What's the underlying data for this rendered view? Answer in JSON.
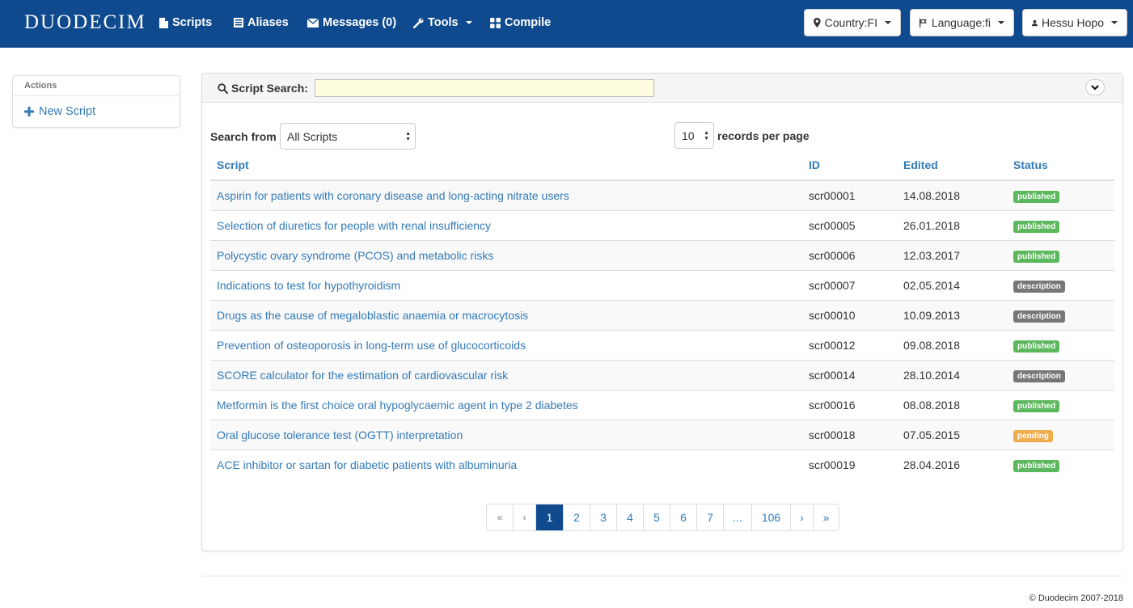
{
  "brand": "DUODECIM",
  "nav": {
    "scripts": "Scripts",
    "aliases": "Aliases",
    "messages": "Messages (0)",
    "tools": "Tools",
    "compile": "Compile",
    "country": "Country:FI",
    "language": "Language:fi",
    "user": "Hessu Hopo"
  },
  "sidebar": {
    "heading": "Actions",
    "new_script": "New Script"
  },
  "search": {
    "label": "Script Search:",
    "value": ""
  },
  "filters": {
    "search_from_label": "Search from",
    "search_from_value": "All Scripts",
    "per_page_value": "10",
    "records_label": "records per page"
  },
  "table": {
    "headers": [
      "Script",
      "ID",
      "Edited",
      "Status"
    ],
    "rows": [
      {
        "script": "Aspirin for patients with coronary disease and long-acting nitrate users",
        "id": "scr00001",
        "edited": "14.08.2018",
        "status": "published"
      },
      {
        "script": "Selection of diuretics for people with renal insufficiency",
        "id": "scr00005",
        "edited": "26.01.2018",
        "status": "published"
      },
      {
        "script": "Polycystic ovary syndrome (PCOS) and metabolic risks",
        "id": "scr00006",
        "edited": "12.03.2017",
        "status": "published"
      },
      {
        "script": "Indications to test for hypothyroidism",
        "id": "scr00007",
        "edited": "02.05.2014",
        "status": "description"
      },
      {
        "script": "Drugs as the cause of megaloblastic anaemia or macrocytosis",
        "id": "scr00010",
        "edited": "10.09.2013",
        "status": "description"
      },
      {
        "script": "Prevention of osteoporosis in long-term use of glucocorticoids",
        "id": "scr00012",
        "edited": "09.08.2018",
        "status": "published"
      },
      {
        "script": "SCORE calculator for the estimation of cardiovascular risk",
        "id": "scr00014",
        "edited": "28.10.2014",
        "status": "description"
      },
      {
        "script": "Metformin is the first choice oral hypoglycaemic agent in type 2 diabetes",
        "id": "scr00016",
        "edited": "08.08.2018",
        "status": "published"
      },
      {
        "script": "Oral glucose tolerance test (OGTT) interpretation",
        "id": "scr00018",
        "edited": "07.05.2015",
        "status": "pending"
      },
      {
        "script": "ACE inhibitor or sartan for diabetic patients with albuminuria",
        "id": "scr00019",
        "edited": "28.04.2016",
        "status": "published"
      }
    ]
  },
  "status_colors": {
    "published": "#5cb85c",
    "description": "#777777",
    "pending": "#f0ad4e"
  },
  "pagination": {
    "items": [
      "«",
      "‹",
      "1",
      "2",
      "3",
      "4",
      "5",
      "6",
      "7",
      "...",
      "106",
      "›",
      "»"
    ],
    "active": "1"
  },
  "footer": "© Duodecim 2007-2018",
  "icons": {
    "scripts": "file-icon",
    "aliases": "list-icon",
    "messages": "envelope-icon",
    "tools": "wrench-icon",
    "compile": "grid-icon",
    "country": "map-marker-icon",
    "language": "flag-icon",
    "user": "user-icon",
    "search": "search-icon",
    "new_script": "plus-icon",
    "collapse": "chevron-down-icon"
  }
}
